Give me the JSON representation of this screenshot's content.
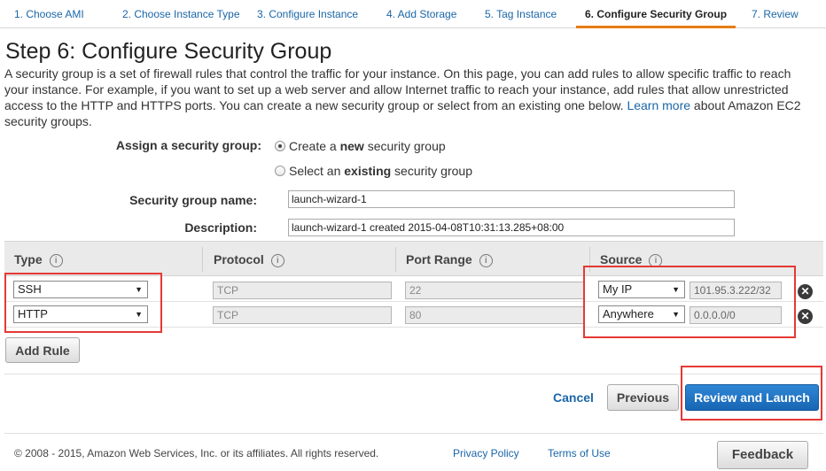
{
  "wizard": {
    "steps": [
      {
        "label": "1. Choose AMI"
      },
      {
        "label": "2. Choose Instance Type"
      },
      {
        "label": "3. Configure Instance"
      },
      {
        "label": "4. Add Storage"
      },
      {
        "label": "5. Tag Instance"
      },
      {
        "label": "6. Configure Security Group"
      },
      {
        "label": "7. Review"
      }
    ],
    "active_index": 5
  },
  "page": {
    "title": "Step 6: Configure Security Group",
    "intro_text": "A security group is a set of firewall rules that control the traffic for your instance. On this page, you can add rules to allow specific traffic to reach your instance. For example, if you want to set up a web server and allow Internet traffic to reach your instance, add rules that allow unrestricted access to the HTTP and HTTPS ports. You can create a new security group or select from an existing one below.",
    "learn_more": "Learn more",
    "intro_suffix": "about Amazon EC2 security groups."
  },
  "assign": {
    "label": "Assign a security group:",
    "option_new_pre": "Create a ",
    "option_new_bold": "new",
    "option_new_post": " security group",
    "option_existing_pre": "Select an ",
    "option_existing_bold": "existing",
    "option_existing_post": " security group",
    "selected": "new"
  },
  "form": {
    "name_label": "Security group name:",
    "name_value": "launch-wizard-1",
    "desc_label": "Description:",
    "desc_value": "launch-wizard-1 created 2015-04-08T10:31:13.285+08:00"
  },
  "table": {
    "headers": {
      "type": "Type",
      "protocol": "Protocol",
      "port_range": "Port Range",
      "source": "Source"
    },
    "info_glyph": "i",
    "rows": [
      {
        "type": "SSH",
        "protocol": "TCP",
        "port": "22",
        "source": "My IP",
        "cidr": "101.95.3.222/32"
      },
      {
        "type": "HTTP",
        "protocol": "TCP",
        "port": "80",
        "source": "Anywhere",
        "cidr": "0.0.0.0/0"
      }
    ],
    "add_rule": "Add Rule"
  },
  "actions": {
    "cancel": "Cancel",
    "previous": "Previous",
    "review_launch": "Review and Launch"
  },
  "footer": {
    "copyright": "© 2008 - 2015, Amazon Web Services, Inc. or its affiliates. All rights reserved.",
    "privacy": "Privacy Policy",
    "terms": "Terms of Use",
    "feedback": "Feedback"
  },
  "icons": {
    "remove": "close-circle-icon",
    "info": "info-circle-icon",
    "dropdown": "caret-down-icon"
  },
  "colors": {
    "link": "#1a66a8",
    "active_tab_underline": "#e77c15",
    "primary_button": "#1f74c4",
    "highlight": "#e53935"
  }
}
